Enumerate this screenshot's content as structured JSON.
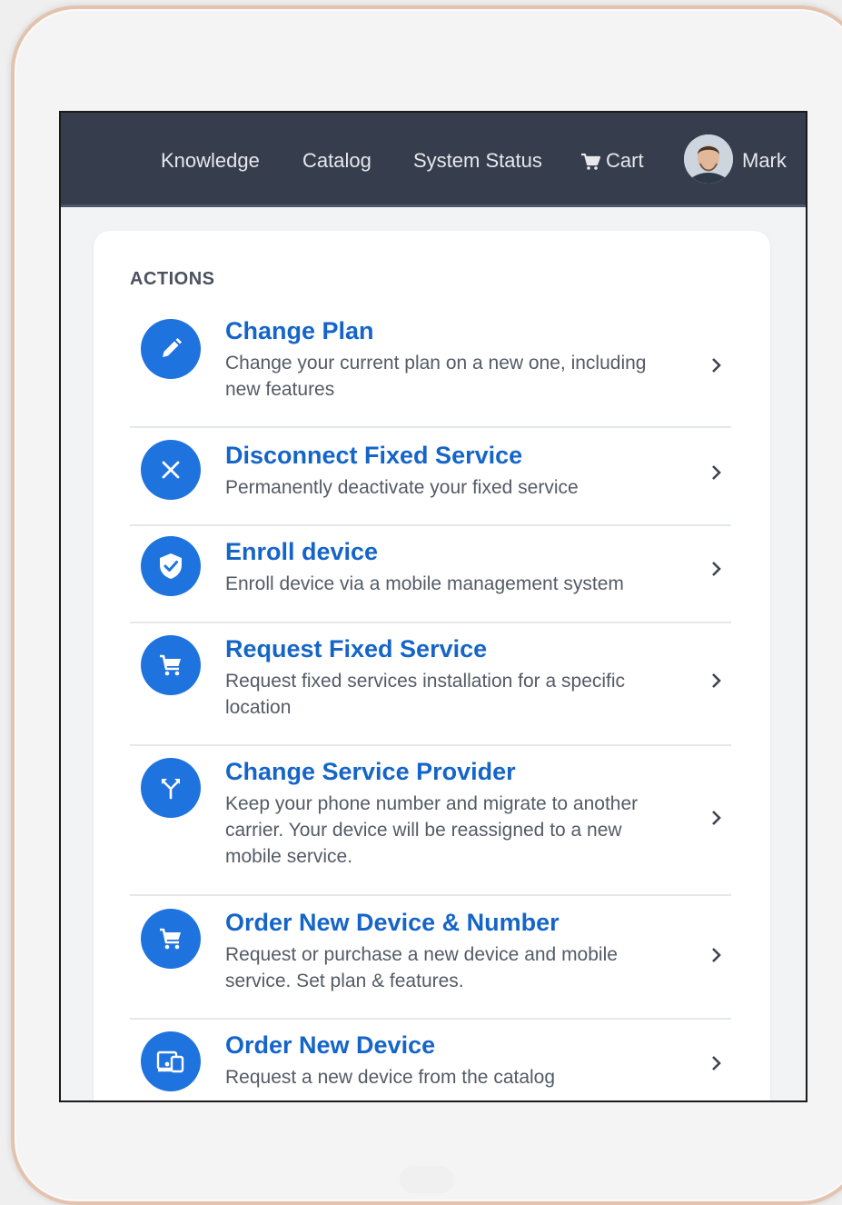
{
  "nav": {
    "knowledge": "Knowledge",
    "catalog": "Catalog",
    "system_status": "System Status",
    "cart": "Cart",
    "user_name": "Mark"
  },
  "actions_heading": "ACTIONS",
  "actions": [
    {
      "title": "Change Plan",
      "description": "Change your current plan on a new one, including new features",
      "icon": "pencil-icon"
    },
    {
      "title": "Disconnect Fixed Service",
      "description": "Permanently deactivate your fixed service",
      "icon": "close-icon"
    },
    {
      "title": "Enroll device",
      "description": "Enroll device via a mobile management system",
      "icon": "shield-check-icon"
    },
    {
      "title": "Request Fixed Service",
      "description": "Request fixed services installation for a specific location",
      "icon": "shopping-cart-icon"
    },
    {
      "title": "Change Service Provider",
      "description": "Keep your phone number and migrate to another carrier. Your device will be reassigned to a new mobile service.",
      "icon": "split-arrows-icon"
    },
    {
      "title": "Order New Device & Number",
      "description": "Request or purchase a new device and mobile service. Set plan & features.",
      "icon": "shopping-cart-icon"
    },
    {
      "title": "Order New Device",
      "description": "Request a new device from the catalog",
      "icon": "devices-icon"
    }
  ],
  "colors": {
    "topbar": "#363d4c",
    "accent_blue": "#1f73de",
    "title_blue": "#1565c8",
    "frame_rose_gold": "#e4c3ae"
  }
}
